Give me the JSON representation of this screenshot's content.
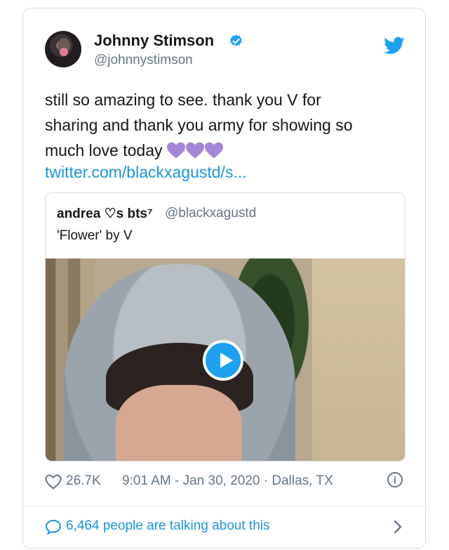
{
  "tweet": {
    "author_name": "Johnny Stimson",
    "author_handle": "@johnnystimson",
    "text_line1": "still so amazing to see. thank you V for",
    "text_line2": "sharing and thank you army for showing so",
    "text_line3": "much love today",
    "hearts": [
      "purple-heart-icon",
      "purple-heart-icon",
      "purple-heart-icon"
    ],
    "link": "twitter.com/blackxagustd/s...",
    "likes": "26.7K",
    "timestamp": "9:01 AM - Jan 30, 2020 · Dallas, TX",
    "talking": "6,464 people are talking about this"
  },
  "quote": {
    "name": "andrea ♡s bts⁷",
    "handle": "@blackxagustd",
    "text": "'Flower' by V"
  },
  "colors": {
    "link_blue": "#1b95e0",
    "twitter_blue": "#1da1f2",
    "heart_purple": "#a686d6",
    "muted_gray": "#657786"
  }
}
